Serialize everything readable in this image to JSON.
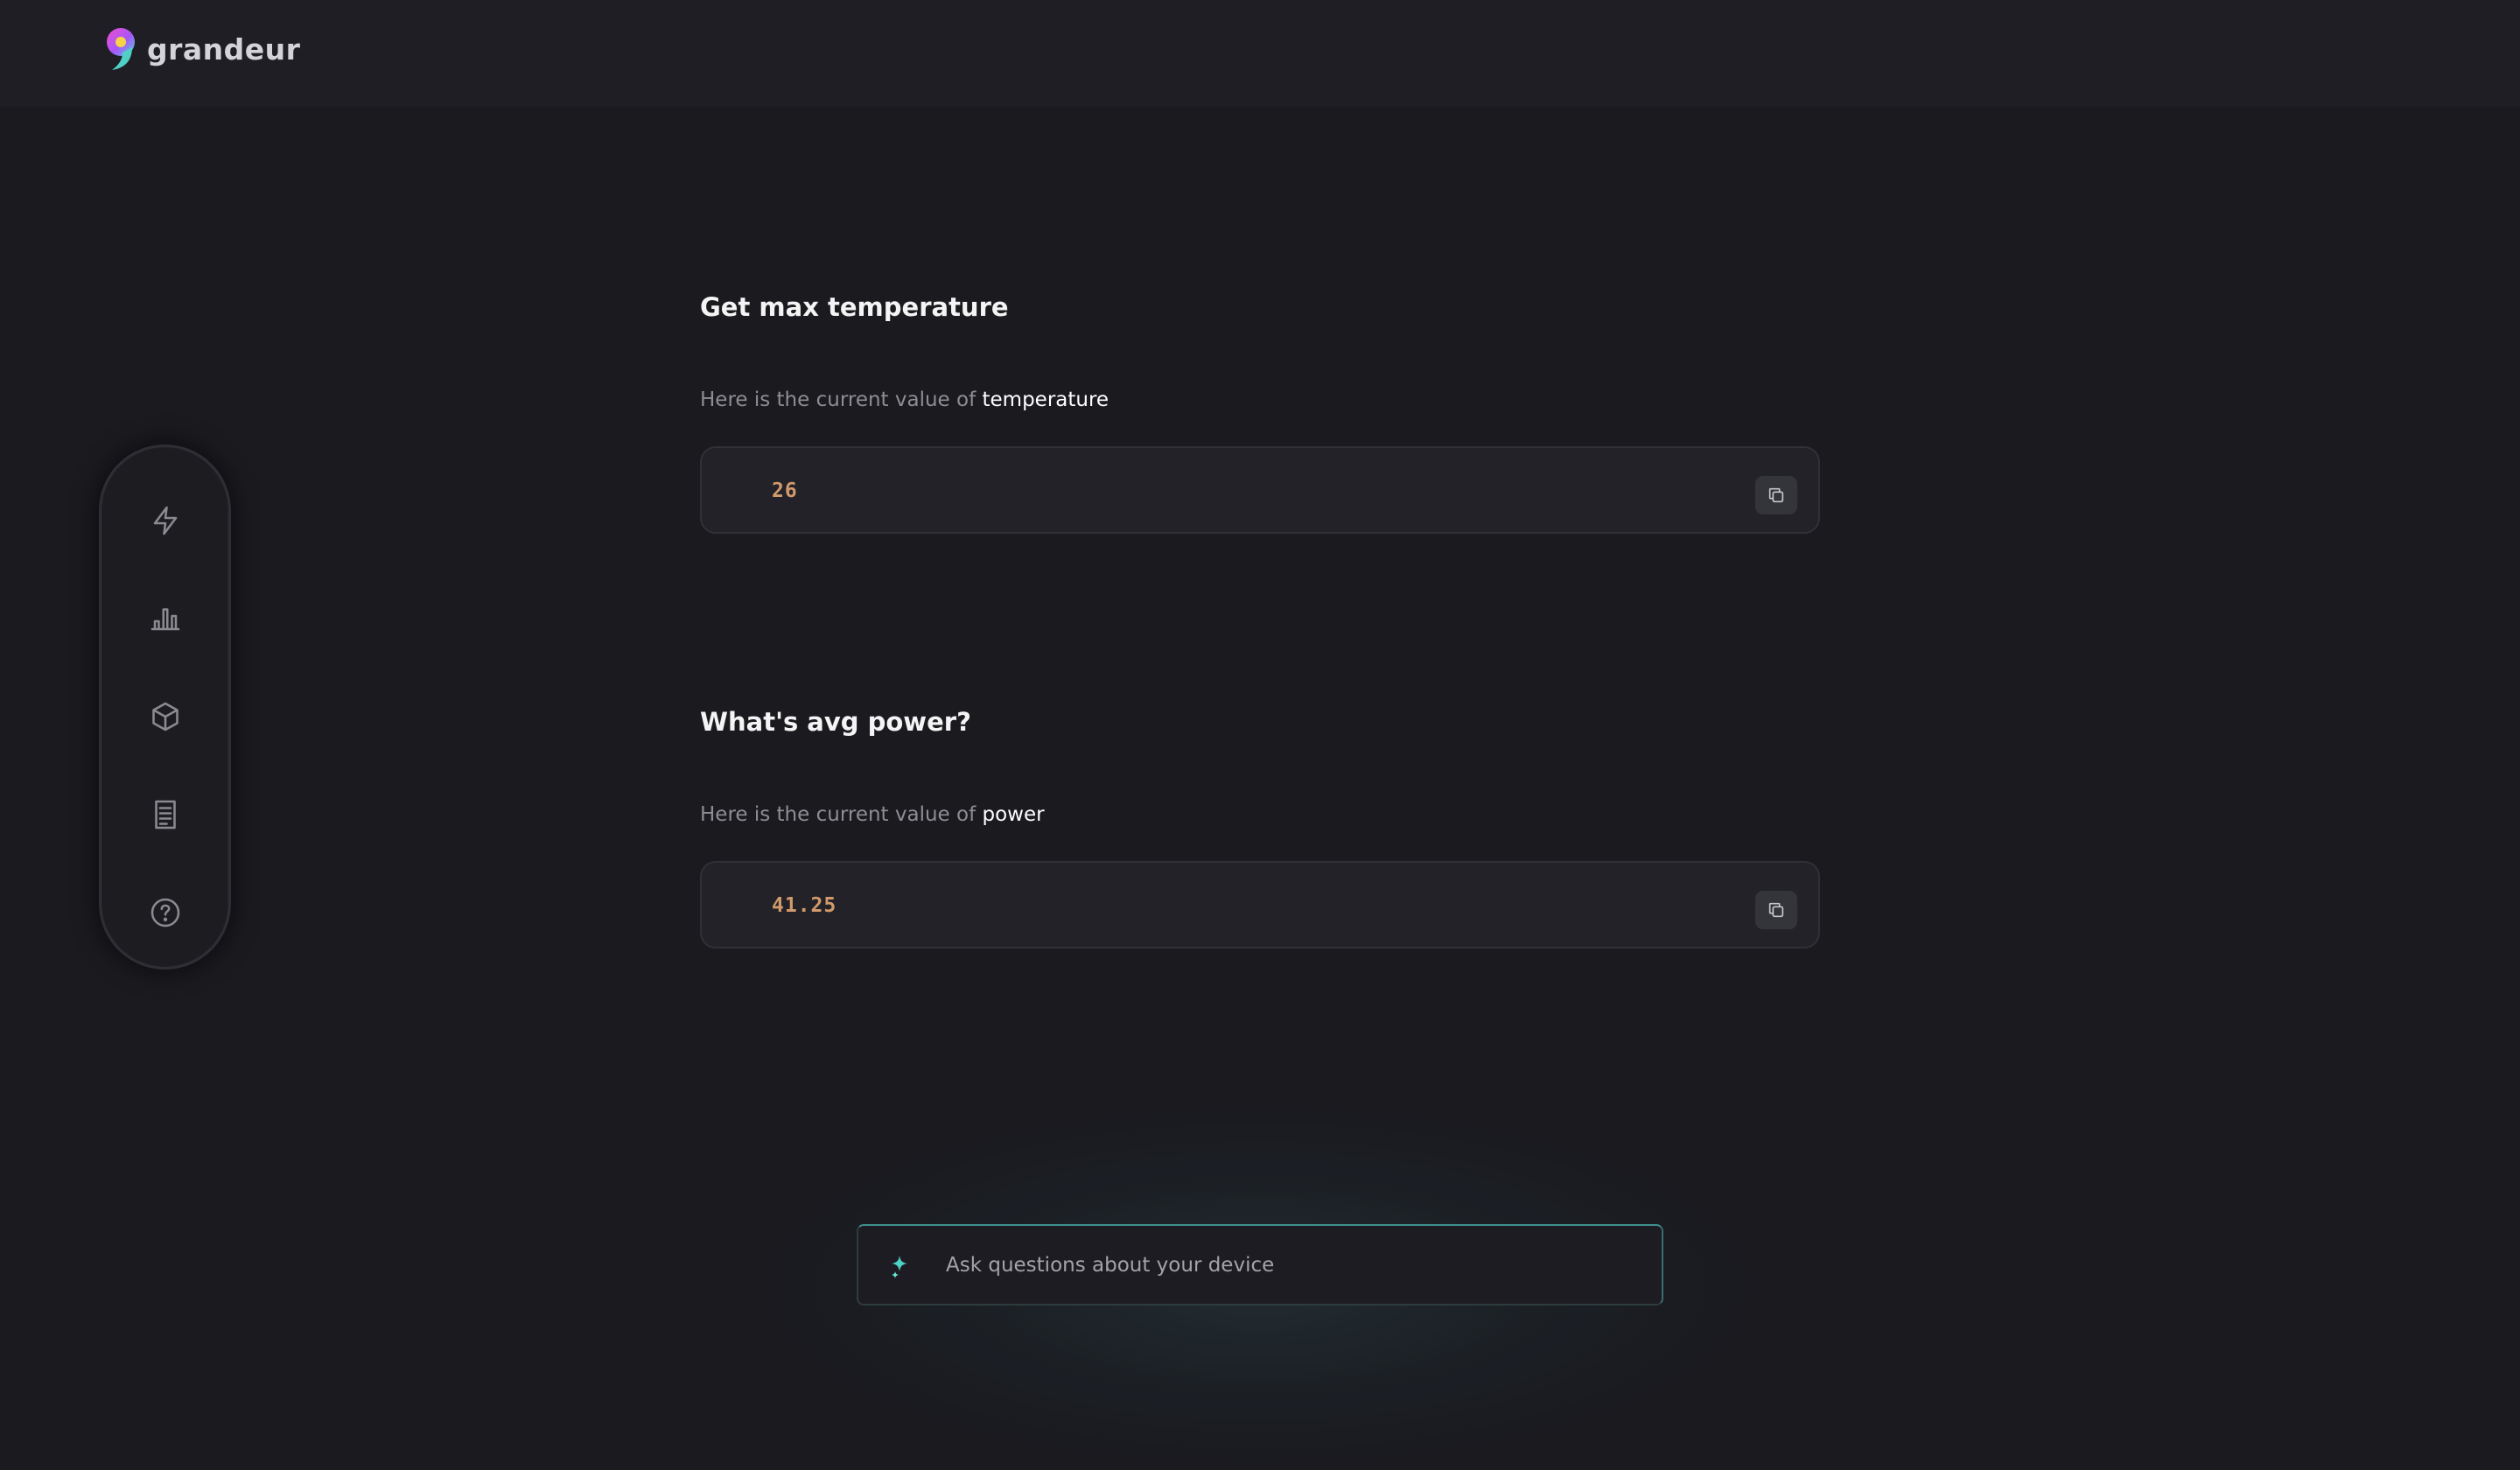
{
  "app": {
    "name": "grandeur"
  },
  "sidebar": {
    "items": [
      {
        "icon": "lightning-icon"
      },
      {
        "icon": "bar-chart-icon"
      },
      {
        "icon": "cube-icon"
      },
      {
        "icon": "document-icon"
      },
      {
        "icon": "help-icon"
      }
    ]
  },
  "conversation": [
    {
      "question": "Get max temperature",
      "answer_prefix": "Here is the current value of ",
      "variable": "temperature",
      "value": "26"
    },
    {
      "question": "What's avg power?",
      "answer_prefix": "Here is the current value of ",
      "variable": "power",
      "value": "41.25"
    }
  ],
  "ask": {
    "placeholder": "Ask questions about your device"
  },
  "colors": {
    "background": "#1a1a1f",
    "topbar": "#1e1e24",
    "value_text": "#d29a6c",
    "accent_teal": "#4fd1c5",
    "logo_pink": "#e94bd6",
    "logo_yellow": "#f5d547"
  }
}
